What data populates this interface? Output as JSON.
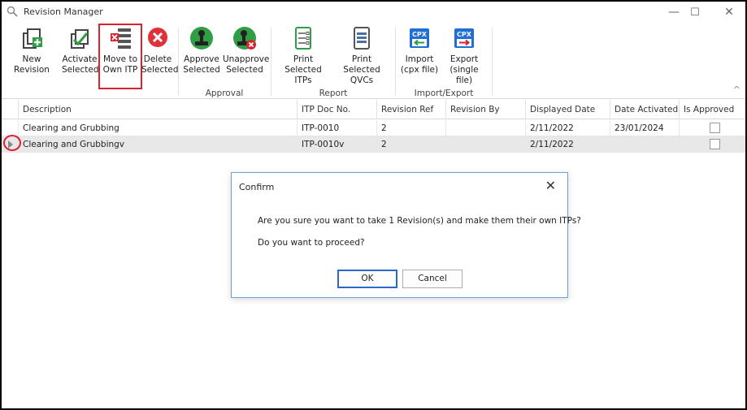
{
  "window": {
    "title": "Revision Manager",
    "minimize_glyph": "—",
    "maximize_glyph": "☐",
    "close_glyph": "✕"
  },
  "ribbon": {
    "new_revision": "New Revision",
    "activate_selected_1": "Activate",
    "activate_selected_2": "Selected",
    "move_to_own_itp_1": "Move to",
    "move_to_own_itp_2": "Own ITP",
    "delete_selected_1": "Delete",
    "delete_selected_2": "Selected",
    "approve_selected_1": "Approve",
    "approve_selected_2": "Selected",
    "unapprove_selected_1": "Unapprove",
    "unapprove_selected_2": "Selected",
    "print_itps_1": "Print",
    "print_itps_2": "Selected ITPs",
    "print_qvcs_1": "Print",
    "print_qvcs_2": "Selected QVCs",
    "import_1": "Import",
    "import_2": "(cpx file)",
    "export_1": "Export",
    "export_2": "(single file)",
    "group_approval": "Approval",
    "group_report": "Report",
    "group_import_export": "Import/Export",
    "cpx_label": "CPX",
    "collapse_glyph": "^"
  },
  "grid": {
    "columns": [
      "Description",
      "ITP Doc No.",
      "Revision Ref",
      "Revision By",
      "Displayed Date",
      "Date Activated",
      "Is Approved"
    ],
    "rows": [
      {
        "description": "Clearing and Grubbing",
        "itp_doc_no": "ITP-0010",
        "revision_ref": "2",
        "revision_by": "",
        "displayed_date": "2/11/2022",
        "date_activated": "23/01/2024",
        "is_approved": false
      },
      {
        "description": "Clearing and Grubbingv",
        "itp_doc_no": "ITP-0010v",
        "revision_ref": "2",
        "revision_by": "",
        "displayed_date": "2/11/2022",
        "date_activated": "",
        "is_approved": false
      }
    ]
  },
  "dialog": {
    "title": "Confirm",
    "close_glyph": "✕",
    "message": "Are you sure you want to take 1 Revision(s) and make them their own ITPs?",
    "prompt": "Do you want to proceed?",
    "ok_label": "OK",
    "cancel_label": "Cancel"
  },
  "colors": {
    "accent_red": "#d9232f",
    "icon_green": "#2f9e44",
    "dialog_border": "#6e9fd3",
    "cpx_blue": "#1f6fd6"
  }
}
